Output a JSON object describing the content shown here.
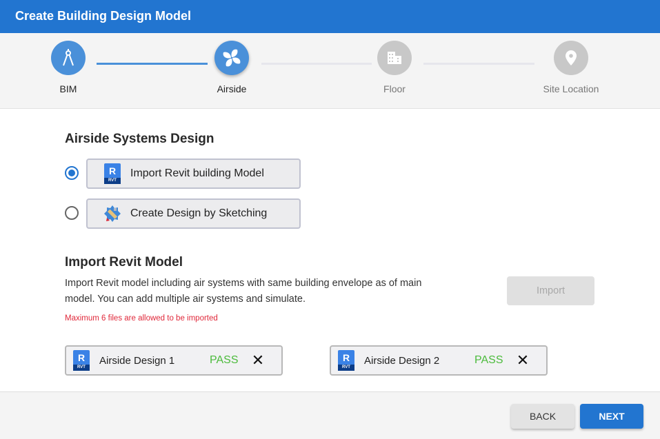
{
  "window": {
    "title": "Create Building Design Model"
  },
  "stepper": {
    "steps": [
      {
        "label": "BIM",
        "icon": "compass-drafting-icon",
        "state": "completed"
      },
      {
        "label": "Airside",
        "icon": "fan-icon",
        "state": "current"
      },
      {
        "label": "Floor",
        "icon": "building-icon",
        "state": "pending"
      },
      {
        "label": "Site Location",
        "icon": "location-pin-icon",
        "state": "pending"
      }
    ]
  },
  "airside": {
    "title": "Airside Systems Design",
    "options": [
      {
        "label": "Import Revit building Model",
        "icon": "revit-rvt-icon",
        "selected": true
      },
      {
        "label": "Create Design by Sketching",
        "icon": "sketch-tool-icon",
        "selected": false
      }
    ]
  },
  "import": {
    "title": "Import Revit Model",
    "description": "Import Revit model including air systems with same building envelope as of main model. You can add multiple air systems and simulate.",
    "warning": "Maximum 6 files are allowed to be imported",
    "button_label": "Import",
    "button_disabled": true,
    "rvt_top": "R",
    "rvt_bottom": "RVT",
    "files": [
      {
        "name": "Airside Design 1",
        "status": "PASS"
      },
      {
        "name": "Airside Design 2",
        "status": "PASS"
      }
    ],
    "remove_glyph": "✕"
  },
  "footer": {
    "back_label": "BACK",
    "next_label": "NEXT"
  },
  "colors": {
    "primary": "#2275d0",
    "step_active": "#4a90d9",
    "step_inactive": "#c8c8c8",
    "pass": "#4cbb3c",
    "warning": "#e0283a"
  }
}
